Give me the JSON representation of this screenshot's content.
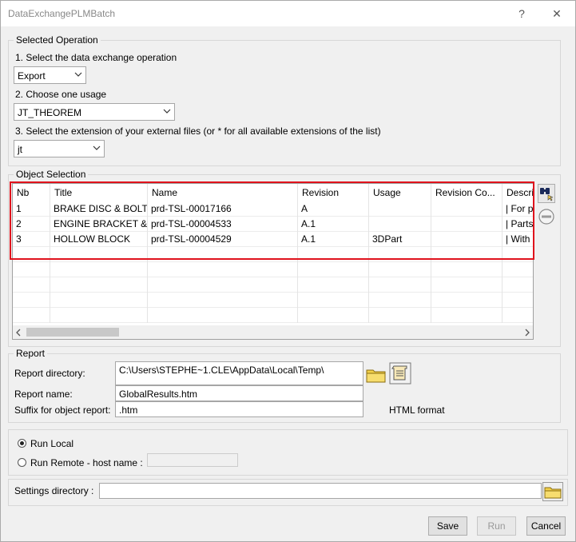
{
  "window": {
    "title": "DataExchangePLMBatch",
    "help": "?",
    "close": "✕"
  },
  "operation": {
    "legend": "Selected Operation",
    "step1_label": "1. Select the data exchange operation",
    "operation_value": "Export",
    "step2_label": "2. Choose one usage",
    "usage_value": "JT_THEOREM",
    "step3_label": "3. Select the extension of your external files (or * for all available extensions of the list)",
    "extension_value": "jt"
  },
  "objects": {
    "legend": "Object Selection",
    "columns": [
      "Nb",
      "Title",
      "Name",
      "Revision",
      "Usage",
      "Revision Co...",
      "Descri"
    ],
    "rows": [
      [
        "1",
        "BRAKE DISC & BOLTS",
        "prd-TSL-00017166",
        "A",
        "",
        "",
        "| For pa"
      ],
      [
        "2",
        "ENGINE BRACKET & ...",
        "prd-TSL-00004533",
        "A.1",
        "",
        "",
        "| Parts v"
      ],
      [
        "3",
        "HOLLOW BLOCK",
        "prd-TSL-00004529",
        "A.1",
        "3DPart",
        "",
        "| With F"
      ]
    ]
  },
  "report": {
    "legend": "Report",
    "dir_label": "Report directory:",
    "dir_value": "C:\\Users\\STEPHE~1.CLE\\AppData\\Local\\Temp\\",
    "name_label": "Report name:",
    "name_value": "GlobalResults.htm",
    "suffix_label": "Suffix for object report:",
    "suffix_value": ".htm",
    "format_label": "HTML format"
  },
  "run": {
    "local_label": "Run Local",
    "local_selected": true,
    "remote_label": "Run Remote - host name :",
    "remote_value": ""
  },
  "settings": {
    "label": "Settings directory :",
    "value": ""
  },
  "buttons": {
    "save": "Save",
    "run": "Run",
    "cancel": "Cancel"
  },
  "colors": {
    "highlight_border": "#e0131d",
    "folder": "#f2d04a"
  }
}
